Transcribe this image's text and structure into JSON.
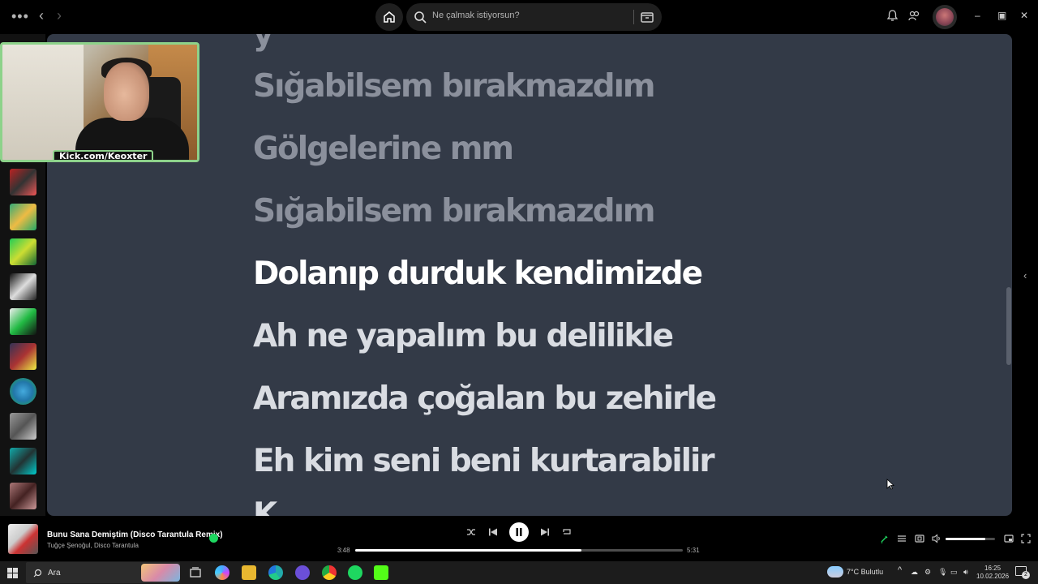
{
  "search": {
    "placeholder": "Ne çalmak istiyorsun?"
  },
  "webcam": {
    "overlay_text": "Kick.com/Keoxter"
  },
  "lyrics": [
    {
      "text": "Sığabilsem bırakmazdım",
      "state": "past"
    },
    {
      "text": "Gölgelerine mm",
      "state": "past"
    },
    {
      "text": "Sığabilsem bırakmazdım",
      "state": "past"
    },
    {
      "text": "Dolanıp durduk kendimizde",
      "state": "current"
    },
    {
      "text": "Ah ne yapalım bu delilikle",
      "state": "future"
    },
    {
      "text": "Aramızda çoğalan bu zehirle",
      "state": "future"
    },
    {
      "text": "Eh kim seni beni kurtarabilir",
      "state": "future"
    }
  ],
  "now_playing": {
    "title": "Bunu Sana Demiştim (Disco Tarantula Remix)",
    "artist": "Tuğçe Şenoğul, Disco Tarantula",
    "elapsed": "3:48",
    "duration": "5:31",
    "progress": 0.69,
    "volume": 0.8
  },
  "taskbar": {
    "search_label": "Ara",
    "weather": "7°C  Bulutlu",
    "time": "16:25",
    "date": "10.02.2026",
    "notifications": "2"
  },
  "colors": {
    "accent": "#1ed760",
    "lyrics_bg": "#333a47",
    "webcam_border": "#8dd28a"
  }
}
